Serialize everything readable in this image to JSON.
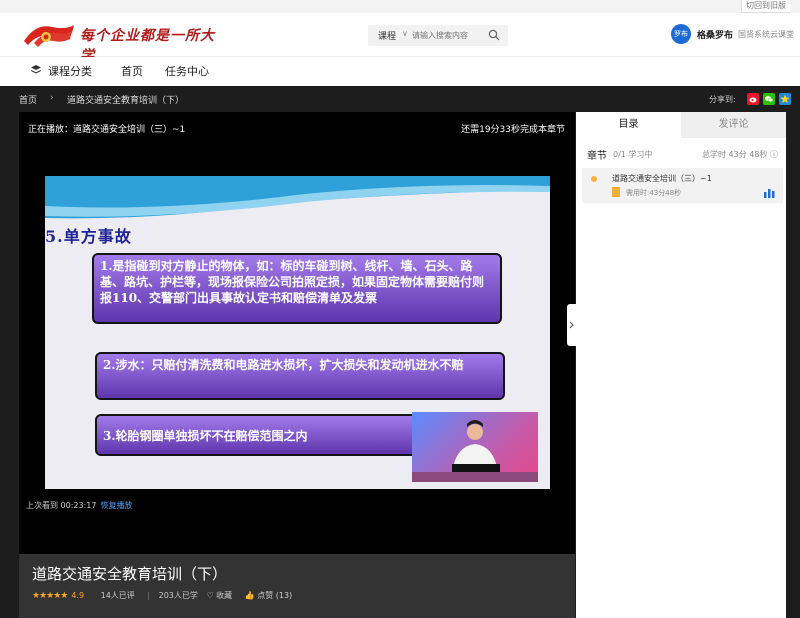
{
  "topbar": {
    "old_version_link": "切回到旧版"
  },
  "header": {
    "logo_text": "每个企业都是一所大学",
    "search": {
      "category": "课程",
      "placeholder": "请输入搜索内容"
    },
    "user": {
      "avatar_text": "罗布",
      "name": "格桑罗布",
      "org": "国贤系统云课堂"
    }
  },
  "nav": {
    "items": [
      "课程分类",
      "首页",
      "任务中心"
    ]
  },
  "breadcrumb": {
    "home": "首页",
    "separator": "›",
    "current": "道路交通安全教育培训（下）"
  },
  "share": {
    "label": "分享到:"
  },
  "player": {
    "now_playing": "正在播放：道路交通安全培训（三）~1",
    "remaining": "还需19分33秒完成本章节",
    "last_watched_label": "上次看到 00:23:17",
    "resume_label": "恢复播放"
  },
  "slide": {
    "title": "5.单方事故",
    "points": [
      "1.是指碰到对方静止的物体，如：标的车碰到树、线杆、墙、石头、路基、路坑、护栏等，现场报保险公司拍照定损，如果固定物体需要赔付则报110、交警部门出具事故认定书和赔偿清单及发票",
      "2.涉水：只赔付清洗费和电路进水损坏，扩大损失和发动机进水不赔",
      "3.轮胎钢圈单独损坏不在赔偿范围之内"
    ]
  },
  "course": {
    "title": "道路交通安全教育培训（下）",
    "rating": "4.9",
    "rating_fraction": 0.98,
    "reviews": "14人已评",
    "learners": "203人已学",
    "favorite": "收藏",
    "likes": "点赞 (13)"
  },
  "panel": {
    "tabs": [
      "目录",
      "发评论"
    ],
    "chapter_label": "章节",
    "progress": "0/1 学习中",
    "total_time": "总学时 43分 48秒",
    "lessons": [
      {
        "title": "道路交通安全培训（三）~1",
        "duration": "需用时:43分48秒"
      }
    ]
  },
  "colors": {
    "accent": "#1e6bd6",
    "brand_red": "#b01c1c",
    "star": "#f5a623",
    "slide_box": "#7a4fc9"
  }
}
